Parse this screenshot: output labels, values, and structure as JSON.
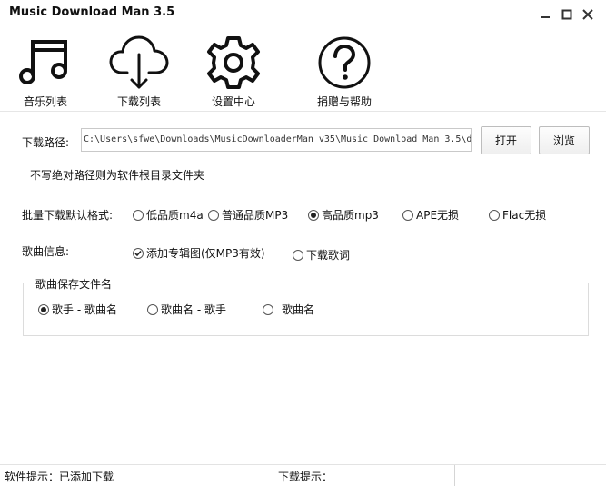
{
  "window": {
    "title": "Music Download Man 3.5",
    "minimize_icon": "minimize-icon",
    "maximize_icon": "maximize-icon",
    "close_icon": "close-icon"
  },
  "toolbar": [
    {
      "label": "音乐列表",
      "icon": "music-note-icon"
    },
    {
      "label": "下载列表",
      "icon": "cloud-download-icon"
    },
    {
      "label": "设置中心",
      "icon": "gear-icon"
    },
    {
      "label": "捐赠与帮助",
      "icon": "help-icon"
    }
  ],
  "download_path": {
    "label": "下载路径:",
    "value": "C:\\Users\\sfwe\\Downloads\\MusicDownloaderMan_v35\\Music Download Man 3.5\\dc",
    "open_button": "打开",
    "browse_button": "浏览",
    "hint": "不写绝对路径则为软件根目录文件夹"
  },
  "batch_format": {
    "label": "批量下载默认格式:",
    "options": [
      "低品质m4a",
      "普通品质MP3",
      "高品质mp3",
      "APE无损",
      "Flac无损"
    ],
    "selected": "高品质mp3"
  },
  "song_info": {
    "label": "歌曲信息:",
    "options": [
      {
        "label": "添加专辑图(仅MP3有效)",
        "checked": true
      },
      {
        "label": "下载歌词",
        "checked": false
      }
    ]
  },
  "filename_group": {
    "legend": "歌曲保存文件名",
    "options": [
      "歌手 - 歌曲名",
      "歌曲名 - 歌手",
      "歌曲名"
    ],
    "selected": "歌手 - 歌曲名"
  },
  "status_bar": {
    "software_tip": "软件提示：已添加下载",
    "download_tip": "下载提示："
  }
}
